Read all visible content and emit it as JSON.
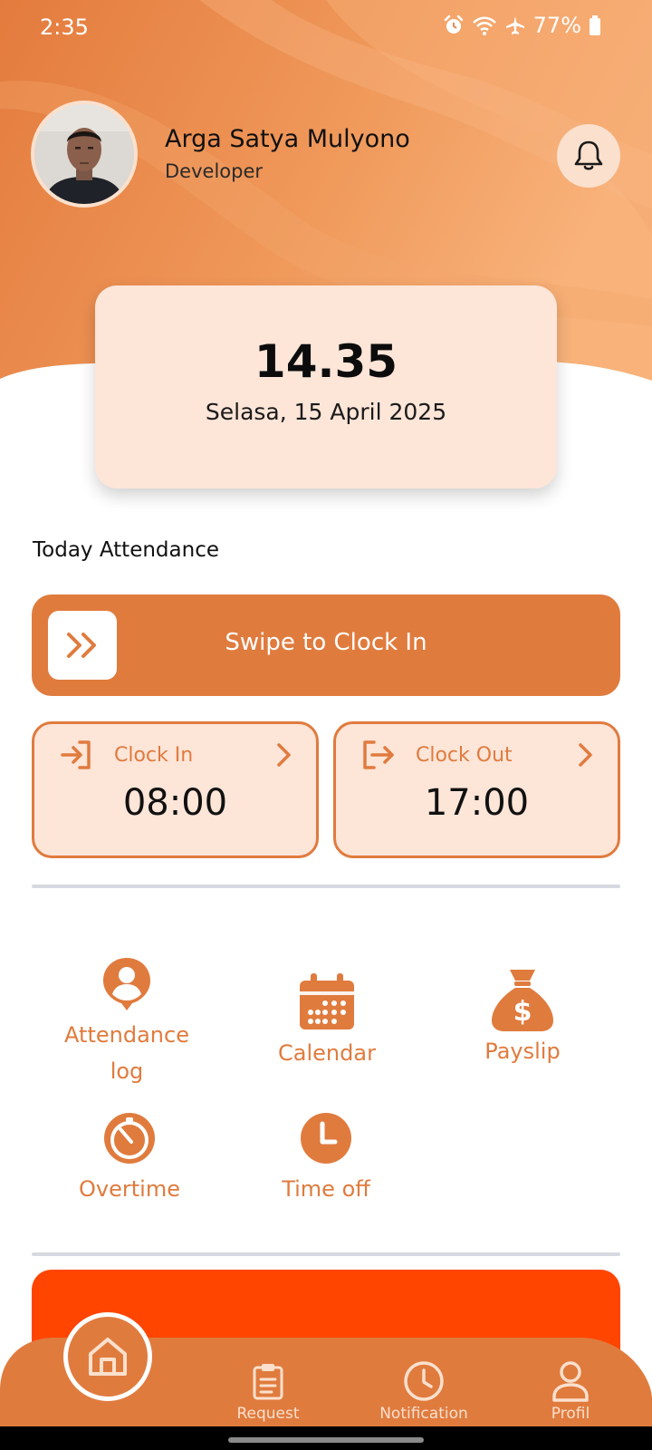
{
  "status_bar": {
    "time": "2:35",
    "battery": "77%"
  },
  "profile": {
    "name": "Arga Satya Mulyono",
    "role": "Developer"
  },
  "clock_card": {
    "time": "14.35",
    "date": "Selasa, 15 April 2025"
  },
  "attendance": {
    "title": "Today Attendance",
    "swipe_label": "Swipe to Clock In",
    "clock_in": {
      "label": "Clock In",
      "value": "08:00"
    },
    "clock_out": {
      "label": "Clock Out",
      "value": "17:00"
    }
  },
  "menu": {
    "attendance_log": {
      "line1": "Attendance",
      "line2": "log",
      "icon": "user-location-icon"
    },
    "calendar": {
      "label": "Calendar",
      "icon": "calendar-icon"
    },
    "payslip": {
      "label": "Payslip",
      "icon": "money-bag-icon"
    },
    "overtime": {
      "label": "Overtime",
      "icon": "stopwatch-icon"
    },
    "time_off": {
      "label": "Time off",
      "icon": "clock-icon"
    }
  },
  "bottom_nav": {
    "home": {
      "icon": "home-icon"
    },
    "request": {
      "label": "Request",
      "icon": "clipboard-icon"
    },
    "notification": {
      "label": "Notification",
      "icon": "clock-icon"
    },
    "profil": {
      "label": "Profil",
      "icon": "person-icon"
    }
  },
  "colors": {
    "accent": "#e07b3e",
    "accent_light": "#fde5d8",
    "banner": "#ff4500"
  }
}
